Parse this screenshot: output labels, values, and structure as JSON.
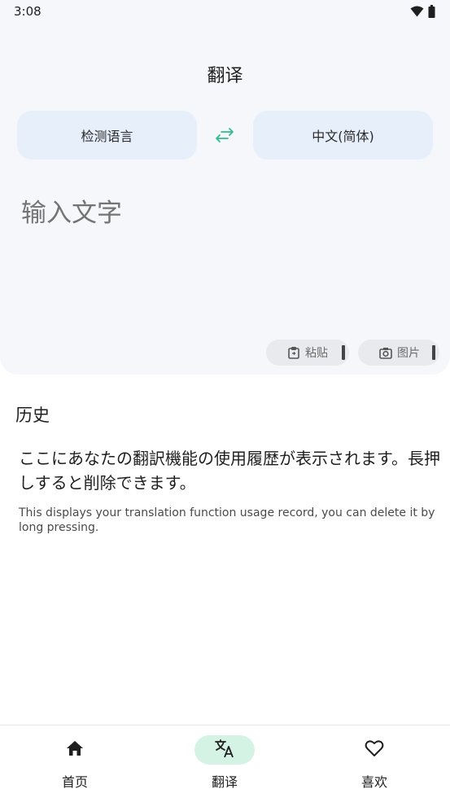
{
  "status": {
    "time": "3:08",
    "wifi_icon": "wifi-icon",
    "battery_icon": "battery-icon"
  },
  "header": {
    "title": "翻译"
  },
  "languages": {
    "source": "检测语言",
    "target": "中文(简体)",
    "swap_icon": "swap-arrows-icon"
  },
  "input": {
    "placeholder": "输入文字",
    "value": ""
  },
  "actions": {
    "paste_label": "粘贴",
    "paste_icon": "clipboard-icon",
    "image_label": "图片",
    "image_icon": "camera-icon"
  },
  "history": {
    "heading": "历史",
    "empty_text_ja": "ここにあなたの翻訳機能の使用履歴が表示されます。長押しすると削除できます。",
    "empty_text_en": "This displays your translation function usage record, you can delete it by long pressing."
  },
  "nav": {
    "items": [
      {
        "label": "首页",
        "icon": "home-icon"
      },
      {
        "label": "翻译",
        "icon": "translate-icon"
      },
      {
        "label": "喜欢",
        "icon": "heart-icon"
      }
    ],
    "active_index": 1
  },
  "colors": {
    "accent": "#2fbf8a",
    "active_pill": "#d4f3e5",
    "lang_button": "#e6effa",
    "panel": "#f6f7fb"
  }
}
